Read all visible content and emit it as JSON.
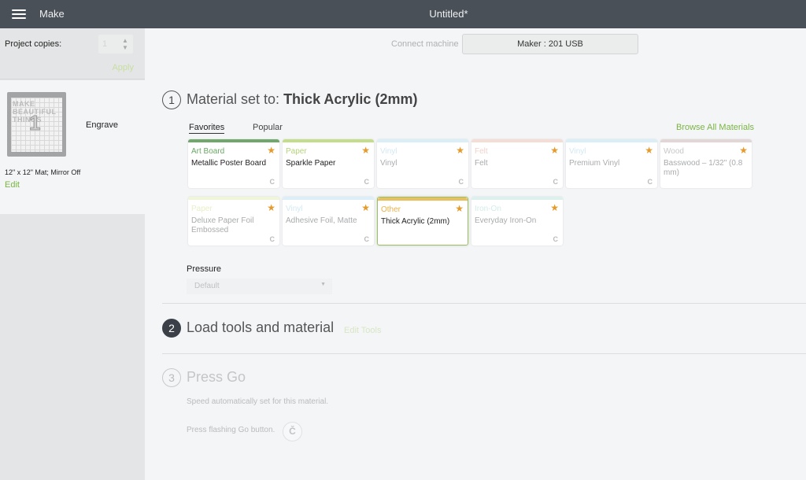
{
  "topbar": {
    "menu_icon": "hamburger-icon",
    "app_title": "Make",
    "document_title": "Untitled*"
  },
  "sidebar": {
    "copies_label": "Project copies:",
    "copies_value": "1",
    "apply_label": "Apply",
    "mat": {
      "thumbnail_text": "MAKE BEAUTIFUL THINGS",
      "thumbnail_number": "1",
      "operation": "Engrave",
      "info": "12\" x 12\" Mat; Mirror Off",
      "edit_label": "Edit"
    }
  },
  "machine": {
    "connect_label": "Connect machine",
    "selected_machine": "Maker : 201 USB"
  },
  "step1": {
    "number": "1",
    "title_prefix": "Material set to:",
    "title_value": "Thick Acrylic (2mm)",
    "tabs": [
      {
        "label": "Favorites",
        "active": true
      },
      {
        "label": "Popular",
        "active": false
      }
    ],
    "browse_label": "Browse All Materials",
    "materials": [
      {
        "category": "Art Board",
        "name": "Metallic Poster Board",
        "bar_color": "#6fa86a",
        "cat_color": "#6aa865",
        "dim": false,
        "selected": false,
        "favorite": true
      },
      {
        "category": "Paper",
        "name": "Sparkle Paper",
        "bar_color": "#c4dd8a",
        "cat_color": "#b5d47a",
        "dim": false,
        "selected": false,
        "favorite": true
      },
      {
        "category": "Vinyl",
        "name": "Vinyl",
        "bar_color": "#d9eef7",
        "cat_color": "#d3e9f3",
        "dim": true,
        "selected": false,
        "favorite": true
      },
      {
        "category": "Felt",
        "name": "Felt",
        "bar_color": "#f5ddd6",
        "cat_color": "#f0d3cc",
        "dim": true,
        "selected": false,
        "favorite": true
      },
      {
        "category": "Vinyl",
        "name": "Premium Vinyl",
        "bar_color": "#d9eef7",
        "cat_color": "#d3e9f3",
        "dim": true,
        "selected": false,
        "favorite": true
      },
      {
        "category": "Wood",
        "name": "Basswood – 1/32\" (0.8 mm)",
        "bar_color": "#e2d6d6",
        "cat_color": "#c8c8c8",
        "dim": true,
        "selected": false,
        "favorite": true
      },
      {
        "category": "Paper",
        "name": "Deluxe Paper Foil Embossed",
        "bar_color": "#eef5d8",
        "cat_color": "#e7f0c8",
        "dim": true,
        "selected": false,
        "favorite": true
      },
      {
        "category": "Vinyl",
        "name": "Adhesive Foil, Matte",
        "bar_color": "#dceef7",
        "cat_color": "#d3e9f3",
        "dim": true,
        "selected": false,
        "favorite": true
      },
      {
        "category": "Other",
        "name": "Thick Acrylic (2mm)",
        "bar_color": "#e9c060",
        "cat_color": "#e8b24a",
        "dim": false,
        "selected": true,
        "favorite": true
      },
      {
        "category": "Iron-On",
        "name": "Everyday Iron-On",
        "bar_color": "#dcf1ee",
        "cat_color": "#d3ede8",
        "dim": true,
        "selected": false,
        "favorite": true
      }
    ],
    "pressure_label": "Pressure",
    "pressure_value": "Default"
  },
  "step2": {
    "number": "2",
    "title": "Load tools and material",
    "edit_tools_label": "Edit Tools"
  },
  "step3": {
    "number": "3",
    "title": "Press Go",
    "speed_text": "Speed automatically set for this material.",
    "press_text": "Press flashing Go button.",
    "go_icon": "cricut-go-icon"
  }
}
